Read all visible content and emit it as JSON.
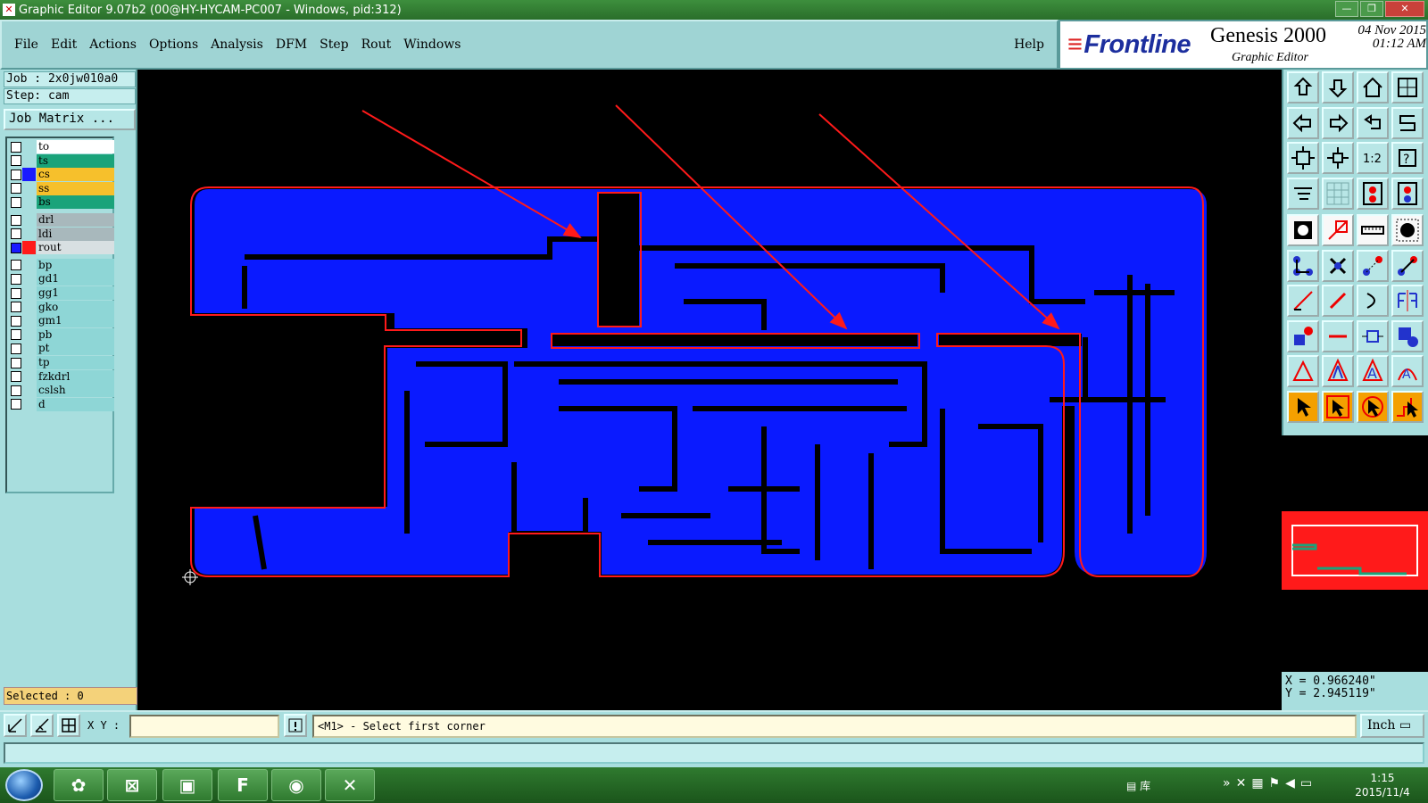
{
  "window": {
    "title": "Graphic Editor 9.07b2 (00@HY-HYCAM-PC007 - Windows, pid:312)",
    "buttons": [
      "—",
      "❐",
      "✕"
    ]
  },
  "menu": {
    "items": [
      "File",
      "Edit",
      "Actions",
      "Options",
      "Analysis",
      "DFM",
      "Step",
      "Rout",
      "Windows"
    ],
    "help": "Help"
  },
  "brand": {
    "logo": "Frontline",
    "product": "Genesis 2000",
    "subtitle": "Graphic Editor",
    "date": "04 Nov 2015",
    "time": "01:12 AM"
  },
  "job": {
    "job_label": "Job : 2x0jw010a0",
    "step_label": "Step: cam",
    "matrix_button": "Job Matrix ..."
  },
  "layers": [
    {
      "name": "to",
      "color": "#ffffff",
      "swatch": ""
    },
    {
      "name": "ts",
      "color": "#1aa37a",
      "swatch": ""
    },
    {
      "name": "cs",
      "color": "#f6c02c",
      "swatch": "#1a1aff"
    },
    {
      "name": "ss",
      "color": "#f6c02c",
      "swatch": ""
    },
    {
      "name": "bs",
      "color": "#1aa37a",
      "swatch": ""
    },
    {
      "name": "drl",
      "color": "#a8b8bc",
      "swatch": ""
    },
    {
      "name": "ldi",
      "color": "#a8b8bc",
      "swatch": ""
    },
    {
      "name": "rout",
      "color": "#d8e0e2",
      "swatch": "#ff1a1a",
      "active": true
    },
    {
      "name": "bp",
      "color": "#8ed6d6",
      "swatch": ""
    },
    {
      "name": "gd1",
      "color": "#8ed6d6",
      "swatch": ""
    },
    {
      "name": "gg1",
      "color": "#8ed6d6",
      "swatch": ""
    },
    {
      "name": "gko",
      "color": "#8ed6d6",
      "swatch": ""
    },
    {
      "name": "gm1",
      "color": "#8ed6d6",
      "swatch": ""
    },
    {
      "name": "pb",
      "color": "#8ed6d6",
      "swatch": ""
    },
    {
      "name": "pt",
      "color": "#8ed6d6",
      "swatch": ""
    },
    {
      "name": "tp",
      "color": "#8ed6d6",
      "swatch": ""
    },
    {
      "name": "fzkdrl",
      "color": "#8ed6d6",
      "swatch": ""
    },
    {
      "name": "cslsh",
      "color": "#8ed6d6",
      "swatch": ""
    },
    {
      "name": "d",
      "color": "#8ed6d6",
      "swatch": ""
    }
  ],
  "selection": {
    "label": "Selected : 0"
  },
  "coords": {
    "x": "X = 0.966240\"",
    "y": "Y = 2.945119\""
  },
  "command": {
    "xy_label": "X Y :",
    "xy_value": "",
    "prompt": "<M1> - Select first corner",
    "units": "Inch"
  },
  "colors": {
    "board": "#0a1aff",
    "outline": "#ff1a1a",
    "panel": "#a8dede"
  },
  "taskbar": {
    "tray_label": "库",
    "time": "1:15",
    "date": "2015/11/4"
  }
}
